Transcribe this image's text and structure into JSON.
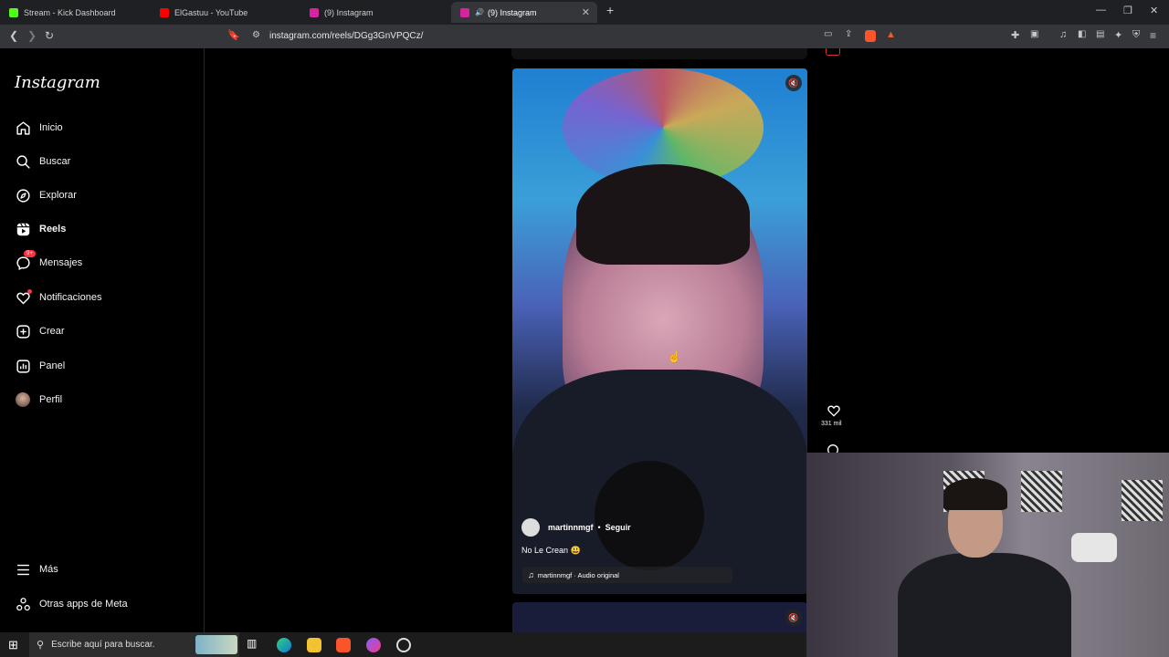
{
  "browser": {
    "tabs": [
      {
        "title": "Stream - Kick Dashboard",
        "favicon": "kick-icon",
        "color": "#53fc18"
      },
      {
        "title": "ElGastuu - YouTube",
        "favicon": "youtube-icon",
        "color": "#ff0000"
      },
      {
        "title": "(9) Instagram",
        "favicon": "instagram-icon",
        "color": "#d6249f"
      },
      {
        "title": "(9) Instagram",
        "favicon": "instagram-icon",
        "color": "#d6249f",
        "active": true,
        "audio": true
      }
    ],
    "url": "instagram.com/reels/DGg3GnVPQCz/"
  },
  "instagram": {
    "logo": "Instagram",
    "nav": {
      "inicio": "Inicio",
      "buscar": "Buscar",
      "explorar": "Explorar",
      "reels": "Reels",
      "mensajes": "Mensajes",
      "mensajes_badge": "9+",
      "notificaciones": "Notificaciones",
      "crear": "Crear",
      "panel": "Panel",
      "perfil": "Perfil",
      "mas": "Más",
      "otras_apps": "Otras apps de Meta"
    },
    "reel": {
      "username": "martinnmgf",
      "separator": "•",
      "follow_label": "Seguir",
      "caption": "No Le Crean 😃",
      "audio_icon": "♫",
      "audio": "martinnmgf · Audio original",
      "likes": "331 mil"
    }
  },
  "taskbar": {
    "search_placeholder": "Escribe aquí para buscar."
  }
}
